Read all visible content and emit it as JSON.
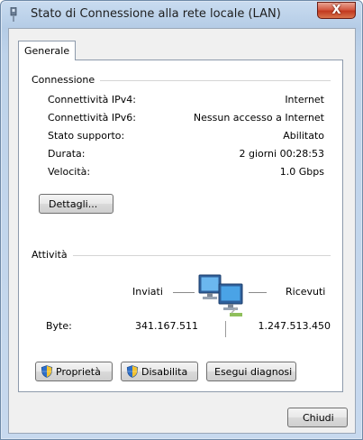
{
  "window": {
    "title": "Stato di Connessione alla rete locale (LAN)",
    "close_symbol": "X"
  },
  "tabs": [
    {
      "label": "Generale",
      "selected": true
    }
  ],
  "connection": {
    "group_label": "Connessione",
    "rows": [
      {
        "label": "Connettività IPv4:",
        "value": "Internet"
      },
      {
        "label": "Connettività IPv6:",
        "value": "Nessun accesso a Internet"
      },
      {
        "label": "Stato supporto:",
        "value": "Abilitato"
      },
      {
        "label": "Durata:",
        "value": "2 giorni 00:28:53"
      },
      {
        "label": "Velocità:",
        "value": "1.0 Gbps"
      }
    ],
    "details_button": "Dettagli..."
  },
  "activity": {
    "group_label": "Attività",
    "sent_label": "Inviati",
    "received_label": "Ricevuti",
    "bytes_label": "Byte:",
    "bytes_sent": "341.167.511",
    "bytes_received": "1.247.513.450"
  },
  "buttons": {
    "properties": "Proprietà",
    "disable": "Disabilita",
    "diagnose": "Esegui diagnosi",
    "close": "Chiudi"
  },
  "icons": {
    "title": "network-adapter-icon",
    "activity": "network-computers-icon",
    "uac": "uac-shield-icon"
  }
}
